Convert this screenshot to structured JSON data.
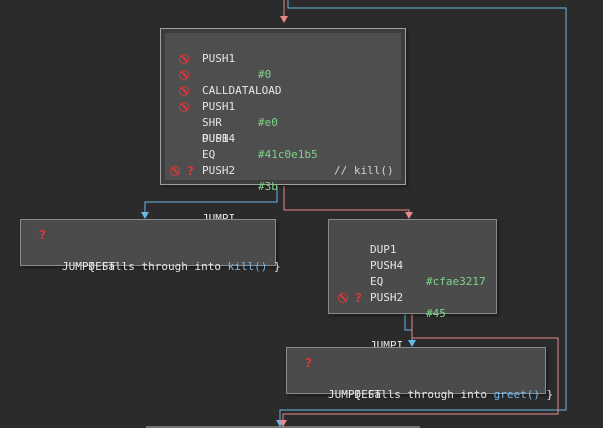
{
  "colors": {
    "background": "#2b2b2b",
    "fallthrough_edge": "#6ab7e6",
    "jump_edge": "#e58a8a",
    "operand": "#7fd38a",
    "warning": "#d23a3a"
  },
  "blocks": {
    "dispatcher": {
      "rows": [
        {
          "op": "PUSH1",
          "arg": "#0"
        },
        {
          "op": "CALLDATALOAD",
          "arg": ""
        },
        {
          "op": "PUSH1",
          "arg": "#e0"
        },
        {
          "op": "SHR",
          "arg": ""
        },
        {
          "op": "DUP1",
          "arg": ""
        },
        {
          "op": "PUSH4",
          "arg": "#41c0e1b5",
          "comment": "// kill()"
        },
        {
          "op": "EQ",
          "arg": ""
        },
        {
          "op": "PUSH2",
          "arg": "#3b"
        },
        {
          "op": "JUMPI",
          "arg": ""
        }
      ]
    },
    "kill_dest": {
      "op": "JUMPDEST",
      "note_prefix": "{ Falls through into ",
      "note_fn": "kill()",
      "note_suffix": " }"
    },
    "greet_check": {
      "rows": [
        {
          "op": "DUP1",
          "arg": ""
        },
        {
          "op": "PUSH4",
          "arg": "#cfae3217"
        },
        {
          "op": "EQ",
          "arg": ""
        },
        {
          "op": "PUSH2",
          "arg": "#45"
        },
        {
          "op": "JUMPI",
          "arg": ""
        }
      ]
    },
    "greet_dest": {
      "op": "JUMPDEST",
      "note_prefix": "{ Falls through into ",
      "note_fn": "greet()",
      "note_suffix": " }"
    }
  },
  "icons": {
    "unreachable": "no-entry-icon",
    "unknown": "question-mark-icon"
  }
}
